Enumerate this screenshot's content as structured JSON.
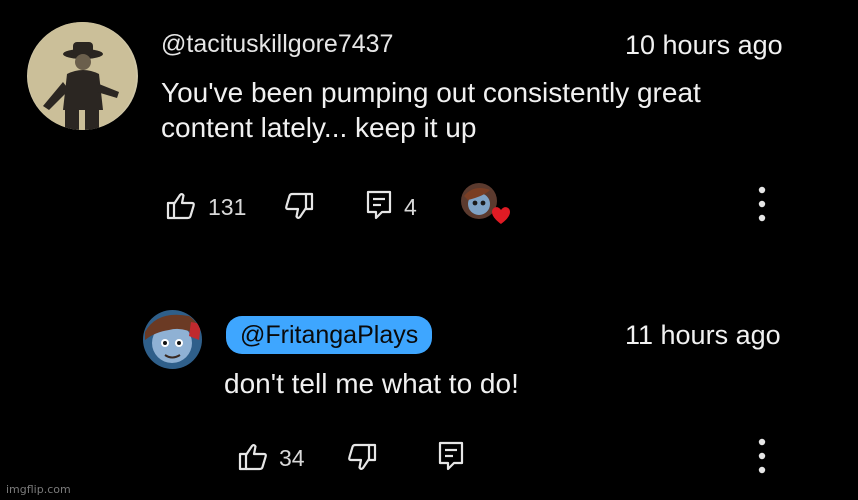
{
  "comment": {
    "author_handle": "@tacituskillgore7437",
    "timestamp": "10 hours ago",
    "text": "You've been pumping out consistently great\ncontent lately... keep it up",
    "like_count": "131",
    "reply_count": "4",
    "icons": {
      "like": "thumbs-up-icon",
      "dislike": "thumbs-down-icon",
      "reply": "comment-icon",
      "creator_heart": "creator-heart-icon",
      "menu": "more-vert-icon"
    }
  },
  "reply": {
    "author_handle": "@FritangaPlays",
    "author_highlight_color": "#3ea6ff",
    "timestamp": "11 hours ago",
    "text": "don't tell me what to do!",
    "like_count": "34"
  },
  "watermark": "imgflip.com",
  "colors": {
    "background": "#000000",
    "text": "#f1f1f1",
    "heart": "#e01b24"
  }
}
